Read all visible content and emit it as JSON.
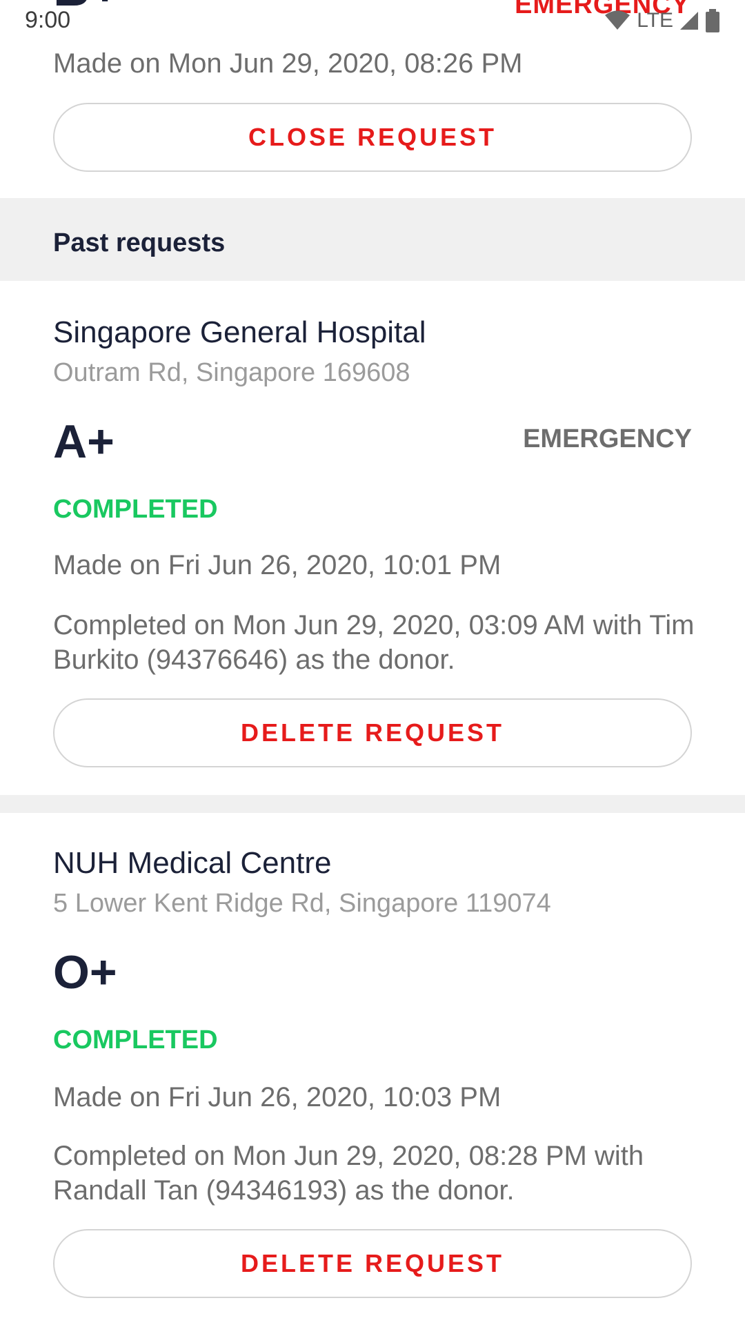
{
  "status_bar": {
    "time": "9:00",
    "network": "LTE",
    "wifi_icon": "wifi-icon",
    "signal_icon": "cell-signal-icon",
    "battery_icon": "battery-icon"
  },
  "active_request": {
    "blood_type": "B+",
    "urgency": "EMERGENCY",
    "made_on": "Made on Mon Jun 29, 2020, 08:26 PM",
    "close_label": "CLOSE REQUEST"
  },
  "past_section": {
    "title": "Past requests"
  },
  "past_requests": [
    {
      "hospital": "Singapore General Hospital",
      "address": "Outram Rd, Singapore 169608",
      "blood_type": "A+",
      "urgency": "EMERGENCY",
      "status": "COMPLETED",
      "made_on": "Made on Fri Jun 26, 2020, 10:01 PM",
      "completed": "Completed on Mon Jun 29, 2020, 03:09 AM with Tim Burkito (94376646) as the donor.",
      "delete_label": "DELETE REQUEST"
    },
    {
      "hospital": "NUH Medical Centre",
      "address": "5 Lower Kent Ridge Rd, Singapore 119074",
      "blood_type": "O+",
      "urgency": "",
      "status": "COMPLETED",
      "made_on": "Made on Fri Jun 26, 2020, 10:03 PM",
      "completed": "Completed on Mon Jun 29, 2020, 08:28 PM with Randall Tan (94346193) as the donor.",
      "delete_label": "DELETE REQUEST"
    }
  ],
  "colors": {
    "accent_red": "#e61b1b",
    "completed_green": "#19c860",
    "text_dark": "#1b2138",
    "text_grey": "#6d6d6d",
    "section_bg": "#f0f0f0"
  }
}
